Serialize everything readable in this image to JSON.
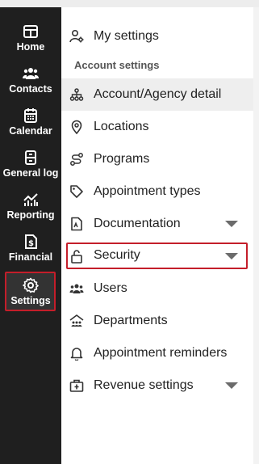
{
  "rail": {
    "items": [
      {
        "label": "Home",
        "icon": "home-icon"
      },
      {
        "label": "Contacts",
        "icon": "contacts-icon"
      },
      {
        "label": "Calendar",
        "icon": "calendar-icon"
      },
      {
        "label": "General log",
        "icon": "general-log-icon"
      },
      {
        "label": "Reporting",
        "icon": "reporting-icon"
      },
      {
        "label": "Financial",
        "icon": "financial-icon"
      },
      {
        "label": "Settings",
        "icon": "gear-icon",
        "active": true
      }
    ]
  },
  "menu": {
    "my_settings": "My settings",
    "section_heading": "Account settings",
    "items": [
      {
        "label": "Account/Agency detail",
        "icon": "org-chart-icon",
        "selected": true
      },
      {
        "label": "Locations",
        "icon": "location-pin-icon"
      },
      {
        "label": "Programs",
        "icon": "route-icon"
      },
      {
        "label": "Appointment types",
        "icon": "tag-icon"
      },
      {
        "label": "Documentation",
        "icon": "document-icon",
        "expandable": true
      },
      {
        "label": "Security",
        "icon": "lock-icon",
        "expandable": true,
        "highlighted": true
      },
      {
        "label": "Users",
        "icon": "users-icon"
      },
      {
        "label": "Departments",
        "icon": "departments-icon"
      },
      {
        "label": "Appointment reminders",
        "icon": "bell-icon"
      },
      {
        "label": "Revenue settings",
        "icon": "revenue-icon",
        "expandable": true
      }
    ]
  },
  "colors": {
    "rail_bg": "#1f1f1f",
    "highlight_border": "#c41e2a",
    "selected_bg": "#eeeeee"
  }
}
